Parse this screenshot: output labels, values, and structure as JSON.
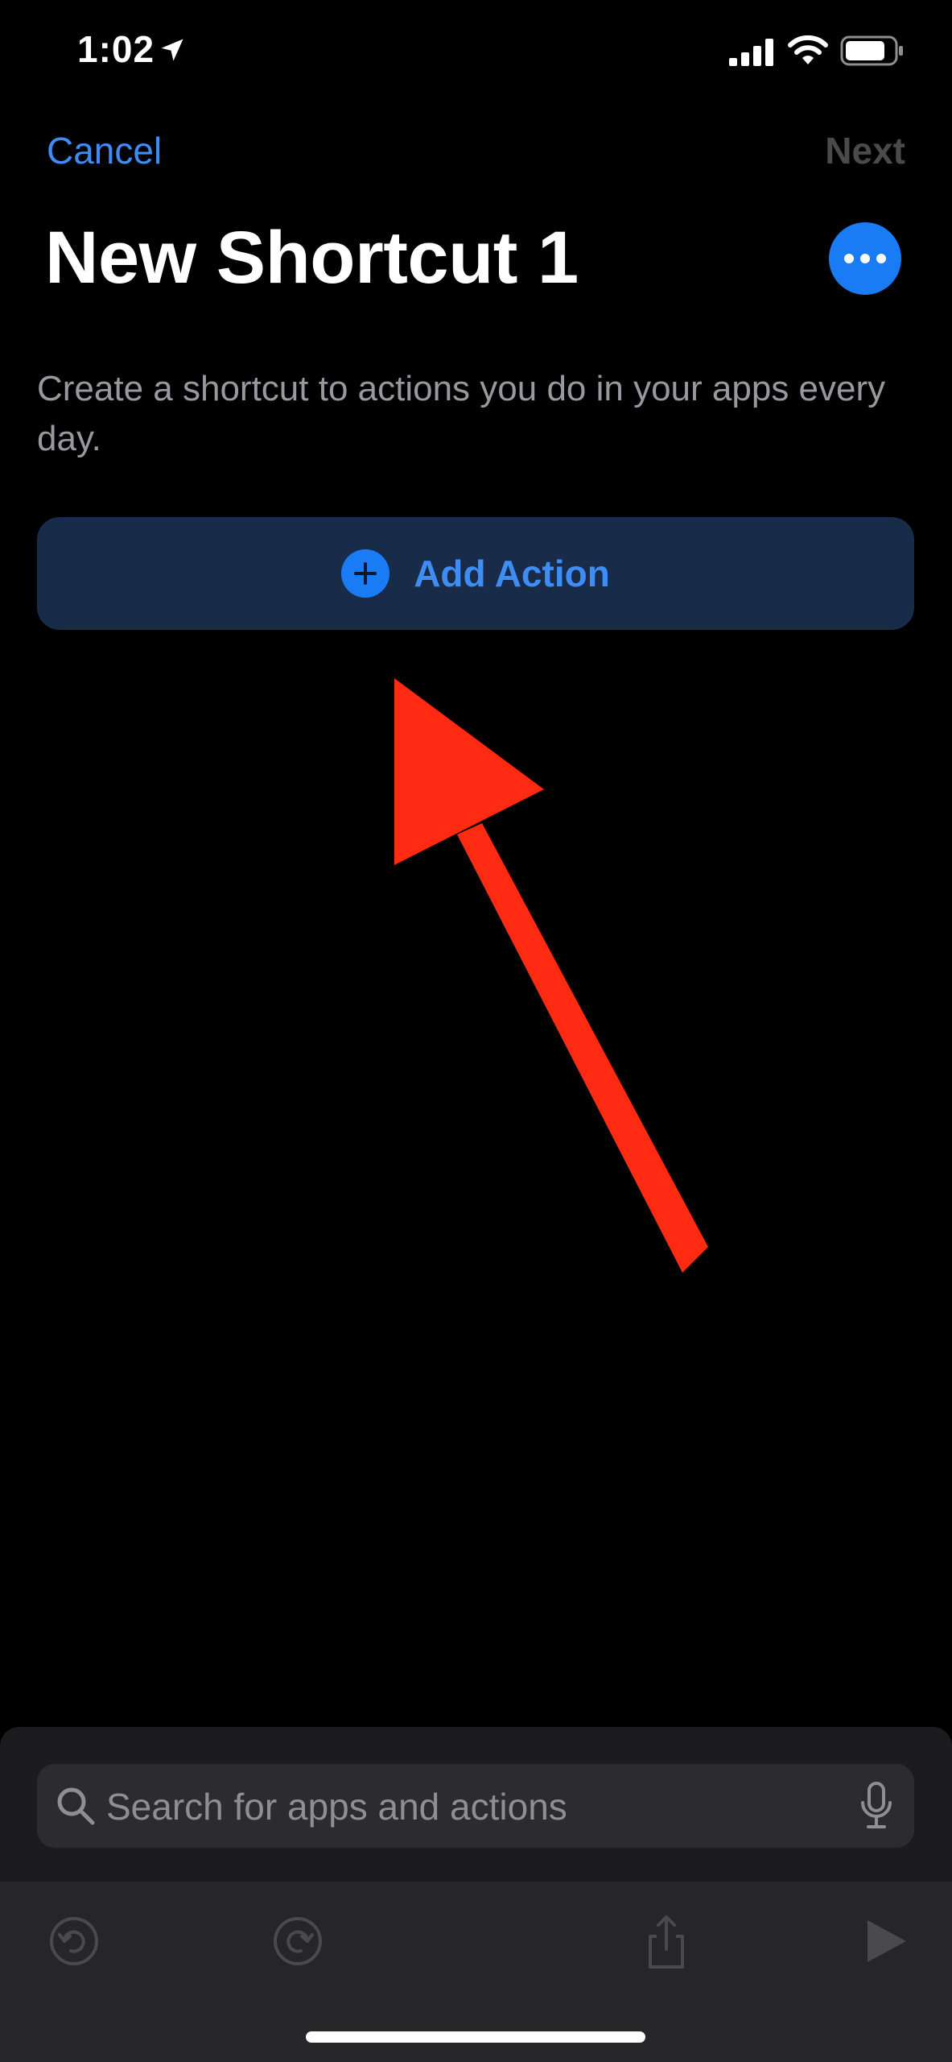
{
  "status_bar": {
    "time": "1:02",
    "icons": [
      "location-arrow-icon",
      "cellular-signal-icon",
      "wifi-icon",
      "battery-icon"
    ]
  },
  "nav": {
    "cancel_label": "Cancel",
    "next_label": "Next"
  },
  "header": {
    "title": "New Shortcut 1",
    "more_icon": "ellipsis-icon"
  },
  "main": {
    "description": "Create a shortcut to actions you do in your apps every day.",
    "add_action_label": "Add Action",
    "add_action_icon": "plus-circle-icon"
  },
  "annotation": {
    "type": "arrow",
    "color": "#ff2a12",
    "points_to": "Add Action"
  },
  "search": {
    "placeholder": "Search for apps and actions",
    "icons": [
      "search-icon",
      "microphone-icon"
    ]
  },
  "toolbar": {
    "items": [
      "undo-icon",
      "redo-icon",
      "share-icon",
      "play-icon"
    ]
  },
  "colors": {
    "accent": "#3d8df5",
    "button_bg": "#182b48",
    "background": "#000000",
    "sheet_bg": "#1c1c1e",
    "disabled": "#4a4a4c"
  }
}
